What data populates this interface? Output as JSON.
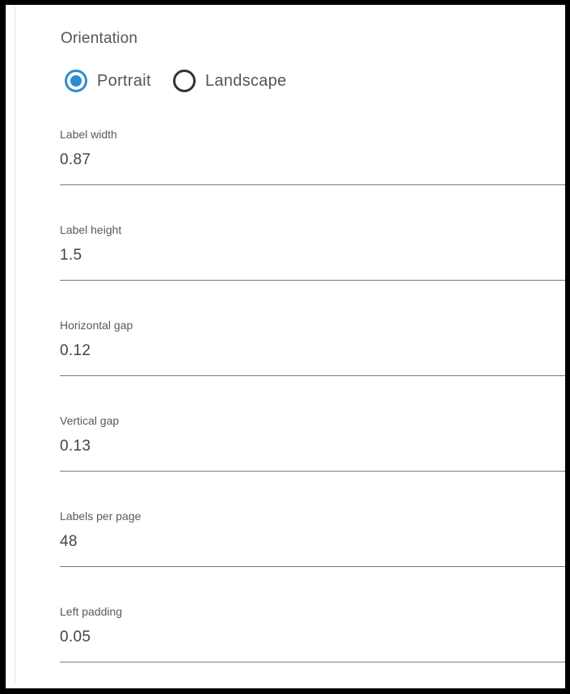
{
  "orientation": {
    "label": "Orientation",
    "options": [
      {
        "label": "Portrait",
        "checked": true
      },
      {
        "label": "Landscape",
        "checked": false
      }
    ]
  },
  "fields": [
    {
      "label": "Label width",
      "value": "0.87"
    },
    {
      "label": "Label height",
      "value": "1.5"
    },
    {
      "label": "Horizontal gap",
      "value": "0.12"
    },
    {
      "label": "Vertical gap",
      "value": "0.13"
    },
    {
      "label": "Labels per page",
      "value": "48"
    },
    {
      "label": "Left padding",
      "value": "0.05"
    }
  ],
  "colors": {
    "accent": "#2f8bd0",
    "text": "#555555",
    "underline": "#7a7a7a"
  }
}
